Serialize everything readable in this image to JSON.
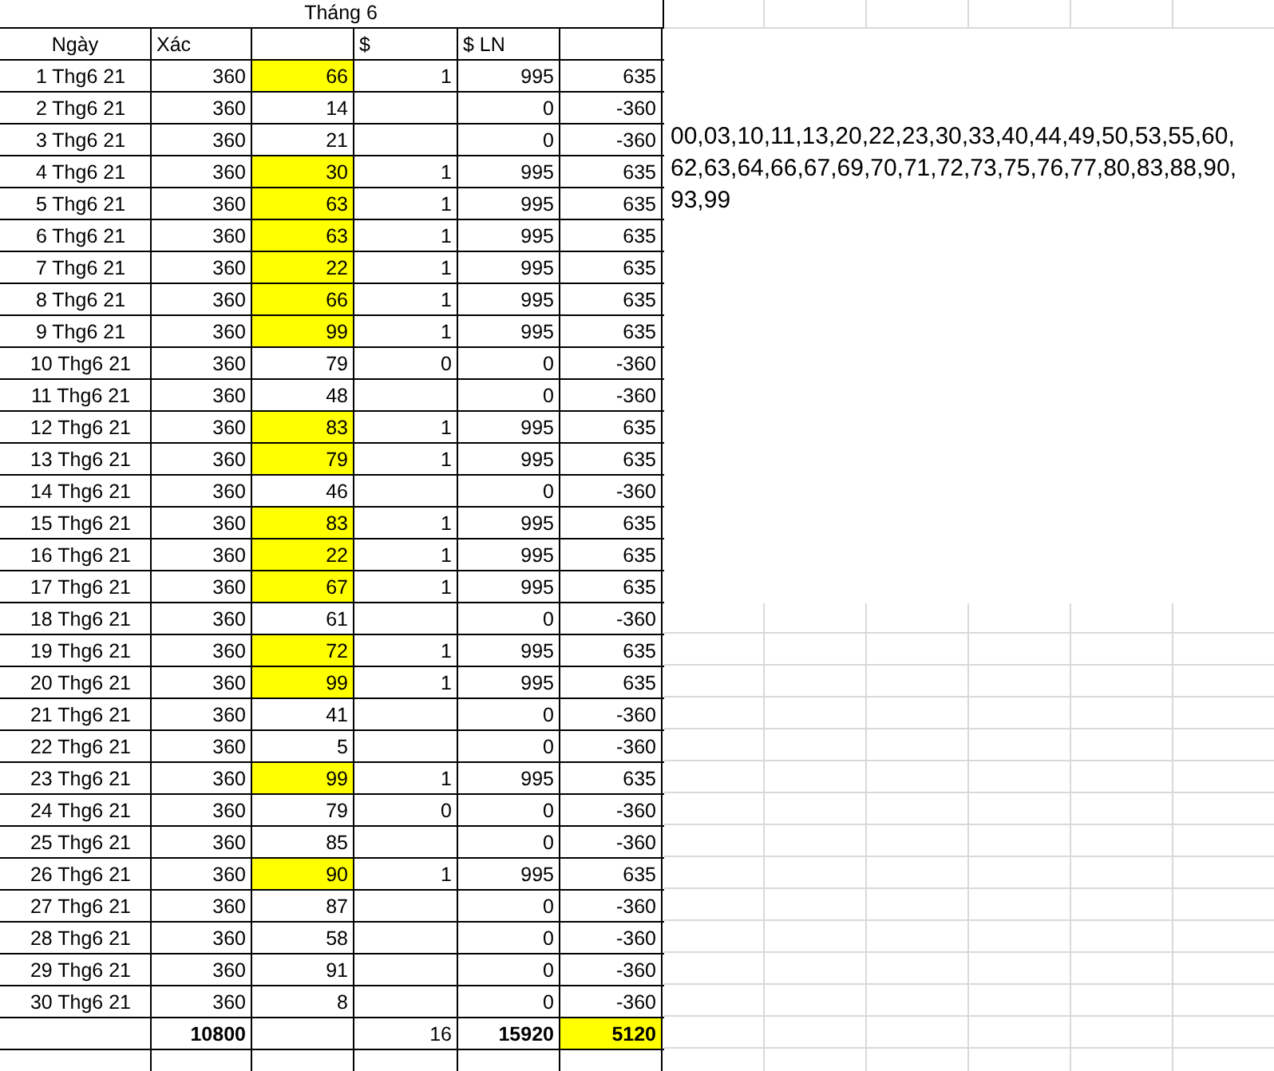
{
  "sheet": {
    "title": "Tháng 6",
    "columns": [
      "Ngày",
      "Xác",
      null,
      "$",
      "$ LN",
      null
    ],
    "rows": [
      {
        "date": "1 Thg6 21",
        "xac": "360",
        "number": "66",
        "highlighted": true,
        "dollar": "1",
        "ln": "995",
        "profit": "635"
      },
      {
        "date": "2 Thg6 21",
        "xac": "360",
        "number": "14",
        "highlighted": false,
        "ln": "0",
        "profit": "-360"
      },
      {
        "date": "3 Thg6 21",
        "xac": "360",
        "number": "21",
        "highlighted": false,
        "ln": "0",
        "profit": "-360"
      },
      {
        "date": "4 Thg6 21",
        "xac": "360",
        "number": "30",
        "highlighted": true,
        "dollar": "1",
        "ln": "995",
        "profit": "635"
      },
      {
        "date": "5 Thg6 21",
        "xac": "360",
        "number": "63",
        "highlighted": true,
        "dollar": "1",
        "ln": "995",
        "profit": "635"
      },
      {
        "date": "6 Thg6 21",
        "xac": "360",
        "number": "63",
        "highlighted": true,
        "dollar": "1",
        "ln": "995",
        "profit": "635"
      },
      {
        "date": "7 Thg6 21",
        "xac": "360",
        "number": "22",
        "highlighted": true,
        "dollar": "1",
        "ln": "995",
        "profit": "635"
      },
      {
        "date": "8 Thg6 21",
        "xac": "360",
        "number": "66",
        "highlighted": true,
        "dollar": "1",
        "ln": "995",
        "profit": "635"
      },
      {
        "date": "9 Thg6 21",
        "xac": "360",
        "number": "99",
        "highlighted": true,
        "dollar": "1",
        "ln": "995",
        "profit": "635"
      },
      {
        "date": "10 Thg6 21",
        "xac": "360",
        "number": "79",
        "highlighted": false,
        "dollar": "0",
        "ln": "0",
        "profit": "-360"
      },
      {
        "date": "11 Thg6 21",
        "xac": "360",
        "number": "48",
        "highlighted": false,
        "ln": "0",
        "profit": "-360"
      },
      {
        "date": "12 Thg6 21",
        "xac": "360",
        "number": "83",
        "highlighted": true,
        "dollar": "1",
        "ln": "995",
        "profit": "635"
      },
      {
        "date": "13 Thg6 21",
        "xac": "360",
        "number": "79",
        "highlighted": true,
        "dollar": "1",
        "ln": "995",
        "profit": "635"
      },
      {
        "date": "14 Thg6 21",
        "xac": "360",
        "number": "46",
        "highlighted": false,
        "ln": "0",
        "profit": "-360"
      },
      {
        "date": "15 Thg6 21",
        "xac": "360",
        "number": "83",
        "highlighted": true,
        "dollar": "1",
        "ln": "995",
        "profit": "635"
      },
      {
        "date": "16 Thg6 21",
        "xac": "360",
        "number": "22",
        "highlighted": true,
        "dollar": "1",
        "ln": "995",
        "profit": "635"
      },
      {
        "date": "17 Thg6 21",
        "xac": "360",
        "number": "67",
        "highlighted": true,
        "dollar": "1",
        "ln": "995",
        "profit": "635"
      },
      {
        "date": "18 Thg6 21",
        "xac": "360",
        "number": "61",
        "highlighted": false,
        "ln": "0",
        "profit": "-360"
      },
      {
        "date": "19 Thg6 21",
        "xac": "360",
        "number": "72",
        "highlighted": true,
        "dollar": "1",
        "ln": "995",
        "profit": "635"
      },
      {
        "date": "20 Thg6 21",
        "xac": "360",
        "number": "99",
        "highlighted": true,
        "dollar": "1",
        "ln": "995",
        "profit": "635"
      },
      {
        "date": "21 Thg6 21",
        "xac": "360",
        "number": "41",
        "highlighted": false,
        "ln": "0",
        "profit": "-360"
      },
      {
        "date": "22 Thg6 21",
        "xac": "360",
        "number": "5",
        "highlighted": false,
        "ln": "0",
        "profit": "-360"
      },
      {
        "date": "23 Thg6 21",
        "xac": "360",
        "number": "99",
        "highlighted": true,
        "dollar": "1",
        "ln": "995",
        "profit": "635"
      },
      {
        "date": "24 Thg6 21",
        "xac": "360",
        "number": "79",
        "highlighted": false,
        "dollar": "0",
        "ln": "0",
        "profit": "-360"
      },
      {
        "date": "25 Thg6 21",
        "xac": "360",
        "number": "85",
        "highlighted": false,
        "ln": "0",
        "profit": "-360"
      },
      {
        "date": "26 Thg6 21",
        "xac": "360",
        "number": "90",
        "highlighted": true,
        "dollar": "1",
        "ln": "995",
        "profit": "635"
      },
      {
        "date": "27 Thg6 21",
        "xac": "360",
        "number": "87",
        "highlighted": false,
        "ln": "0",
        "profit": "-360"
      },
      {
        "date": "28 Thg6 21",
        "xac": "360",
        "number": "58",
        "highlighted": false,
        "ln": "0",
        "profit": "-360"
      },
      {
        "date": "29 Thg6 21",
        "xac": "360",
        "number": "91",
        "highlighted": false,
        "ln": "0",
        "profit": "-360"
      },
      {
        "date": "30 Thg6 21",
        "xac": "360",
        "number": "8",
        "highlighted": false,
        "ln": "0",
        "profit": "-360"
      }
    ],
    "totals": [
      {
        "highlighted": false
      },
      {
        "text": "10800",
        "bold": true,
        "highlighted": false
      },
      {
        "highlighted": false
      },
      {
        "text": "16",
        "bold": false,
        "highlighted": false
      },
      {
        "text": "15920",
        "bold": true,
        "highlighted": false
      },
      {
        "text": "5120",
        "bold": true,
        "highlighted": true
      }
    ]
  },
  "note": {
    "lines": [
      "00,03,10,11,13,20,22,23,30,33,40,44,49,50,53,55,60,",
      "62,63,64,66,67,69,70,71,72,73,75,76,77,80,83,88,90,",
      "93,99"
    ]
  }
}
